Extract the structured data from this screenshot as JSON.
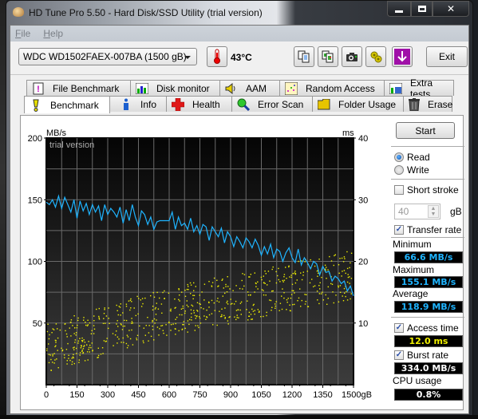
{
  "window": {
    "title": "HD Tune Pro 5.50 - Hard Disk/SSD Utility (trial version)",
    "controls": {
      "minimize": "minimize-icon",
      "maximize": "maximize-icon",
      "close": "close-icon"
    }
  },
  "menu": {
    "items": [
      {
        "label": "File",
        "accel": "F"
      },
      {
        "label": "Help",
        "accel": "H"
      }
    ]
  },
  "toolbar": {
    "drive": "WDC WD1502FAEX-007BA (1500 gB)",
    "temperature": "43°C",
    "icons": [
      "copy-text-icon",
      "copy-image-icon",
      "screenshot-camera-icon",
      "options-gears-icon",
      "save-download-icon"
    ],
    "exit_label": "Exit",
    "colors": {
      "download_icon": "#a010a8"
    }
  },
  "tabs": {
    "row1": [
      {
        "label": "File Benchmark",
        "icon": "file-benchmark-icon"
      },
      {
        "label": "Disk monitor",
        "icon": "disk-monitor-icon"
      },
      {
        "label": "AAM",
        "icon": "speaker-icon"
      },
      {
        "label": "Random Access",
        "icon": "random-access-icon"
      },
      {
        "label": "Extra tests",
        "icon": "extra-tests-icon"
      }
    ],
    "row2": [
      {
        "label": "Benchmark",
        "icon": "benchmark-icon",
        "active": true
      },
      {
        "label": "Info",
        "icon": "info-icon"
      },
      {
        "label": "Health",
        "icon": "health-cross-icon"
      },
      {
        "label": "Error Scan",
        "icon": "magnifier-icon"
      },
      {
        "label": "Folder Usage",
        "icon": "folder-icon"
      },
      {
        "label": "Erase",
        "icon": "trash-icon"
      }
    ]
  },
  "side": {
    "start_label": "Start",
    "mode": {
      "options": [
        "Read",
        "Write"
      ],
      "selected": "Read"
    },
    "short_stroke": {
      "label": "Short stroke",
      "checked": false,
      "value": "40",
      "unit": "gB"
    },
    "transfer_rate": {
      "label": "Transfer rate",
      "checked": true
    },
    "minimum_label": "Minimum",
    "minimum": "66.6 MB/s",
    "maximum_label": "Maximum",
    "maximum": "155.1 MB/s",
    "average_label": "Average",
    "average": "118.9 MB/s",
    "access_time": {
      "label": "Access time",
      "checked": true,
      "value": "12.0 ms"
    },
    "burst_rate": {
      "label": "Burst rate",
      "checked": true,
      "value": "334.0 MB/s"
    },
    "cpu_label": "CPU usage",
    "cpu": "0.8%",
    "colors": {
      "transfer": "#1fb4ff",
      "access": "#f0f000"
    }
  },
  "chart_data": {
    "type": "line",
    "title": "",
    "watermark": "trial version",
    "ylabel_left": "MB/s",
    "ylabel_right": "ms",
    "xlabel": "gB",
    "xlim": [
      0,
      1500
    ],
    "ylim_left": [
      0,
      200
    ],
    "ylim_right": [
      0,
      40
    ],
    "x_ticks": [
      "0",
      "150",
      "300",
      "450",
      "600",
      "750",
      "900",
      "1050",
      "1200",
      "1350",
      "1500gB"
    ],
    "y_ticks_left": [
      "200",
      "150",
      "100",
      "50"
    ],
    "y_ticks_right": [
      "40",
      "30",
      "20",
      "10"
    ],
    "grid": true,
    "series": [
      {
        "name": "Transfer rate (MB/s)",
        "axis": "left",
        "color": "#1fb4ff",
        "x": [
          0,
          15,
          30,
          45,
          60,
          75,
          90,
          105,
          120,
          135,
          150,
          165,
          180,
          195,
          210,
          225,
          240,
          255,
          270,
          285,
          300,
          315,
          330,
          345,
          360,
          375,
          390,
          405,
          420,
          435,
          450,
          465,
          480,
          495,
          510,
          525,
          540,
          555,
          570,
          585,
          600,
          615,
          630,
          645,
          660,
          675,
          690,
          705,
          720,
          735,
          750,
          765,
          780,
          795,
          810,
          825,
          840,
          855,
          870,
          885,
          900,
          915,
          930,
          945,
          960,
          975,
          990,
          1005,
          1020,
          1035,
          1050,
          1065,
          1080,
          1095,
          1110,
          1125,
          1140,
          1155,
          1170,
          1185,
          1200,
          1215,
          1230,
          1245,
          1260,
          1275,
          1290,
          1305,
          1320,
          1335,
          1350,
          1365,
          1380,
          1395,
          1410,
          1425,
          1440,
          1455,
          1470,
          1485,
          1500
        ],
        "y": [
          148,
          146,
          150,
          144,
          153,
          143,
          152,
          146,
          140,
          150,
          135,
          149,
          141,
          147,
          138,
          146,
          140,
          145,
          133,
          146,
          138,
          143,
          140,
          136,
          144,
          131,
          142,
          133,
          146,
          136,
          129,
          141,
          138,
          130,
          136,
          126,
          132,
          133,
          133,
          133,
          133,
          140,
          126,
          136,
          129,
          131,
          126,
          135,
          124,
          129,
          122,
          130,
          128,
          117,
          128,
          124,
          120,
          127,
          115,
          124,
          120,
          112,
          120,
          116,
          111,
          119,
          116,
          111,
          118,
          113,
          105,
          112,
          106,
          114,
          103,
          110,
          108,
          100,
          107,
          111,
          103,
          99,
          110,
          97,
          103,
          99,
          94,
          100,
          98,
          89,
          96,
          91,
          92,
          84,
          88,
          86,
          82,
          84,
          76,
          80,
          72
        ],
        "stats": {
          "minimum": 66.6,
          "maximum": 155.1,
          "average": 118.9
        }
      },
      {
        "name": "Access time (ms)",
        "axis": "right",
        "color": "#f0f000",
        "kind": "scatter",
        "trend_ms": {
          "x": [
            0,
            300,
            600,
            900,
            1200,
            1500
          ],
          "low": [
            2,
            5,
            8,
            10,
            12,
            14
          ],
          "high": [
            10,
            13,
            16,
            18,
            20,
            22
          ]
        },
        "average_ms": 12.0
      }
    ]
  }
}
